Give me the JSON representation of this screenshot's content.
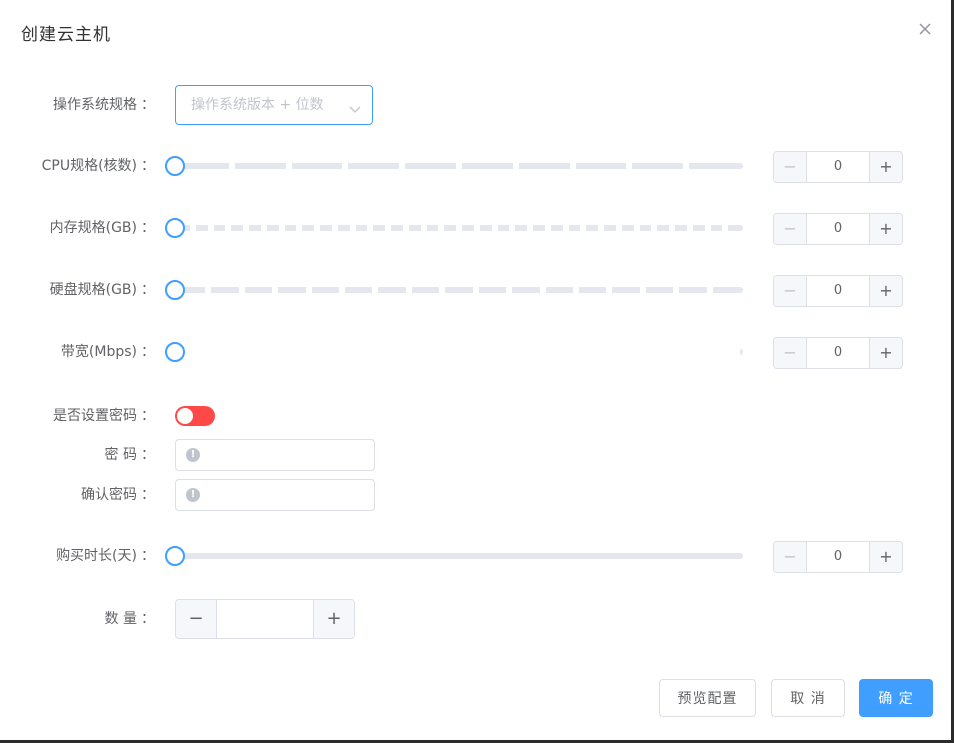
{
  "dialog": {
    "title": "创建云主机"
  },
  "form": {
    "os": {
      "label": "操作系统规格",
      "placeholder": "操作系统版本 + 位数"
    },
    "cpu": {
      "label": "CPU规格(核数)",
      "value": "0",
      "dec": "−",
      "inc": "+",
      "stops": 9
    },
    "memory": {
      "label": "内存规格(GB)",
      "value": "0",
      "dec": "−",
      "inc": "+",
      "stops": 31
    },
    "disk": {
      "label": "硬盘规格(GB)",
      "value": "0",
      "dec": "−",
      "inc": "+",
      "stops": 16
    },
    "bandwidth": {
      "label": "带宽(Mbps)",
      "value": "0",
      "dec": "−",
      "inc": "+",
      "stops": 99
    },
    "set_password": {
      "label": "是否设置密码",
      "enabled": false,
      "active_color": "#ff4949"
    },
    "password": {
      "label": "密 码",
      "value": ""
    },
    "confirm_password": {
      "label": "确认密码",
      "value": ""
    },
    "duration": {
      "label": "购买时长(天)",
      "value": "0",
      "dec": "−",
      "inc": "+"
    },
    "quantity": {
      "label": "数 量",
      "value": "",
      "dec": "−",
      "inc": "+"
    },
    "colon": "："
  },
  "footer": {
    "preview_label": "预览配置",
    "cancel_label": "取 消",
    "confirm_label": "确 定"
  },
  "colors": {
    "primary": "#409eff",
    "danger": "#ff4949",
    "border": "#dcdfe6",
    "track": "#e4e7ed"
  }
}
